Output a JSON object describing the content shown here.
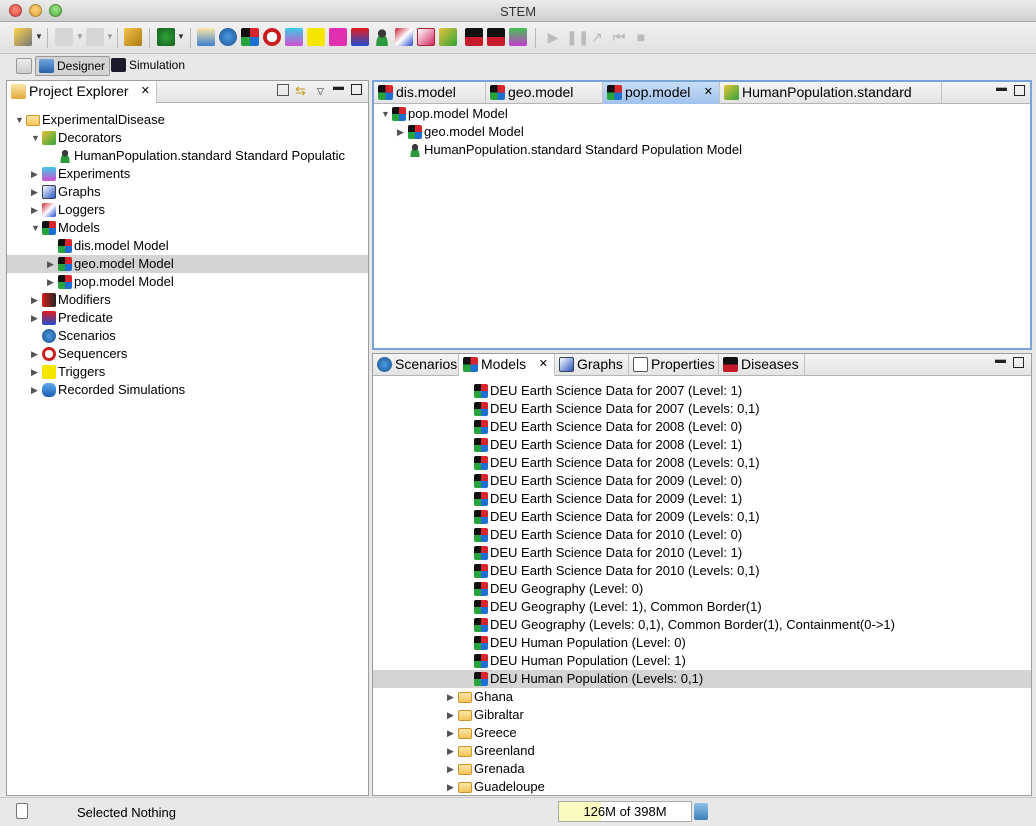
{
  "window": {
    "title": "STEM"
  },
  "perspectives": [
    {
      "label": "Designer",
      "active": true
    },
    {
      "label": "Simulation",
      "active": false
    }
  ],
  "explorer": {
    "title": "Project Explorer",
    "items": [
      {
        "label": "ExperimentalDisease",
        "depth": 0,
        "twisty": "open",
        "icon": "folder-project-icon"
      },
      {
        "label": "Decorators",
        "depth": 1,
        "twisty": "open",
        "icon": "decorator-icon"
      },
      {
        "label": "HumanPopulation.standard Standard Populatic",
        "depth": 2,
        "twisty": "none",
        "icon": "person-icon"
      },
      {
        "label": "Experiments",
        "depth": 1,
        "twisty": "closed",
        "icon": "experiment-icon"
      },
      {
        "label": "Graphs",
        "depth": 1,
        "twisty": "closed",
        "icon": "graph-icon"
      },
      {
        "label": "Loggers",
        "depth": 1,
        "twisty": "closed",
        "icon": "logger-icon"
      },
      {
        "label": "Models",
        "depth": 1,
        "twisty": "open",
        "icon": "models-icon"
      },
      {
        "label": "dis.model Model",
        "depth": 2,
        "twisty": "none",
        "icon": "model-icon"
      },
      {
        "label": "geo.model Model",
        "depth": 2,
        "twisty": "closed",
        "icon": "model-icon",
        "selected": true
      },
      {
        "label": "pop.model Model",
        "depth": 2,
        "twisty": "closed",
        "icon": "model-icon"
      },
      {
        "label": "Modifiers",
        "depth": 1,
        "twisty": "closed",
        "icon": "modifier-icon"
      },
      {
        "label": "Predicate",
        "depth": 1,
        "twisty": "closed",
        "icon": "predicate-icon"
      },
      {
        "label": "Scenarios",
        "depth": 1,
        "twisty": "none",
        "icon": "scenario-icon"
      },
      {
        "label": "Sequencers",
        "depth": 1,
        "twisty": "closed",
        "icon": "sequencer-icon"
      },
      {
        "label": "Triggers",
        "depth": 1,
        "twisty": "closed",
        "icon": "trigger-icon"
      },
      {
        "label": "Recorded Simulations",
        "depth": 1,
        "twisty": "closed",
        "icon": "database-icon"
      }
    ]
  },
  "editor": {
    "tabs": [
      {
        "label": "dis.model",
        "icon": "model-icon",
        "active": false
      },
      {
        "label": "geo.model",
        "icon": "model-icon",
        "active": false
      },
      {
        "label": "pop.model",
        "icon": "model-icon",
        "active": true
      },
      {
        "label": "HumanPopulation.standard",
        "icon": "decorator-icon",
        "active": false
      }
    ],
    "tree": [
      {
        "label": "pop.model Model",
        "depth": 0,
        "twisty": "open",
        "icon": "model-icon"
      },
      {
        "label": "geo.model Model",
        "depth": 1,
        "twisty": "closed",
        "icon": "model-icon"
      },
      {
        "label": "HumanPopulation.standard Standard Population Model",
        "depth": 1,
        "twisty": "none",
        "icon": "person-icon"
      }
    ]
  },
  "library": {
    "tabs": [
      {
        "label": "Scenarios",
        "icon": "scenario-icon",
        "active": false
      },
      {
        "label": "Models",
        "icon": "model-icon",
        "active": true
      },
      {
        "label": "Graphs",
        "icon": "graph-icon",
        "active": false
      },
      {
        "label": "Properties",
        "icon": "properties-icon",
        "active": false
      },
      {
        "label": "Diseases",
        "icon": "disease-icon",
        "active": false
      }
    ],
    "items": [
      {
        "label": "DEU Earth Science Data for 2007 (Level: 1)",
        "kind": "model"
      },
      {
        "label": "DEU Earth Science Data for 2007 (Levels: 0,1)",
        "kind": "model"
      },
      {
        "label": "DEU Earth Science Data for 2008 (Level: 0)",
        "kind": "model"
      },
      {
        "label": "DEU Earth Science Data for 2008 (Level: 1)",
        "kind": "model"
      },
      {
        "label": "DEU Earth Science Data for 2008 (Levels: 0,1)",
        "kind": "model"
      },
      {
        "label": "DEU Earth Science Data for 2009 (Level: 0)",
        "kind": "model"
      },
      {
        "label": "DEU Earth Science Data for 2009 (Level: 1)",
        "kind": "model"
      },
      {
        "label": "DEU Earth Science Data for 2009 (Levels: 0,1)",
        "kind": "model"
      },
      {
        "label": "DEU Earth Science Data for 2010 (Level: 0)",
        "kind": "model"
      },
      {
        "label": "DEU Earth Science Data for 2010 (Level: 1)",
        "kind": "model"
      },
      {
        "label": "DEU Earth Science Data for 2010 (Levels: 0,1)",
        "kind": "model"
      },
      {
        "label": "DEU Geography (Level: 0)",
        "kind": "model"
      },
      {
        "label": "DEU Geography (Level: 1), Common Border(1)",
        "kind": "model"
      },
      {
        "label": "DEU Geography (Levels: 0,1), Common Border(1), Containment(0->1)",
        "kind": "model"
      },
      {
        "label": "DEU Human Population (Level: 0)",
        "kind": "model"
      },
      {
        "label": "DEU Human Population (Level: 1)",
        "kind": "model"
      },
      {
        "label": "DEU Human Population (Levels: 0,1)",
        "kind": "model",
        "selected": true
      },
      {
        "label": "Ghana",
        "kind": "folder"
      },
      {
        "label": "Gibraltar",
        "kind": "folder"
      },
      {
        "label": "Greece",
        "kind": "folder"
      },
      {
        "label": "Greenland",
        "kind": "folder"
      },
      {
        "label": "Grenada",
        "kind": "folder"
      },
      {
        "label": "Guadeloupe",
        "kind": "folder"
      }
    ]
  },
  "status": {
    "text": "Selected Nothing",
    "heap": "126M of 398M",
    "heap_used_fraction": 0.32
  }
}
